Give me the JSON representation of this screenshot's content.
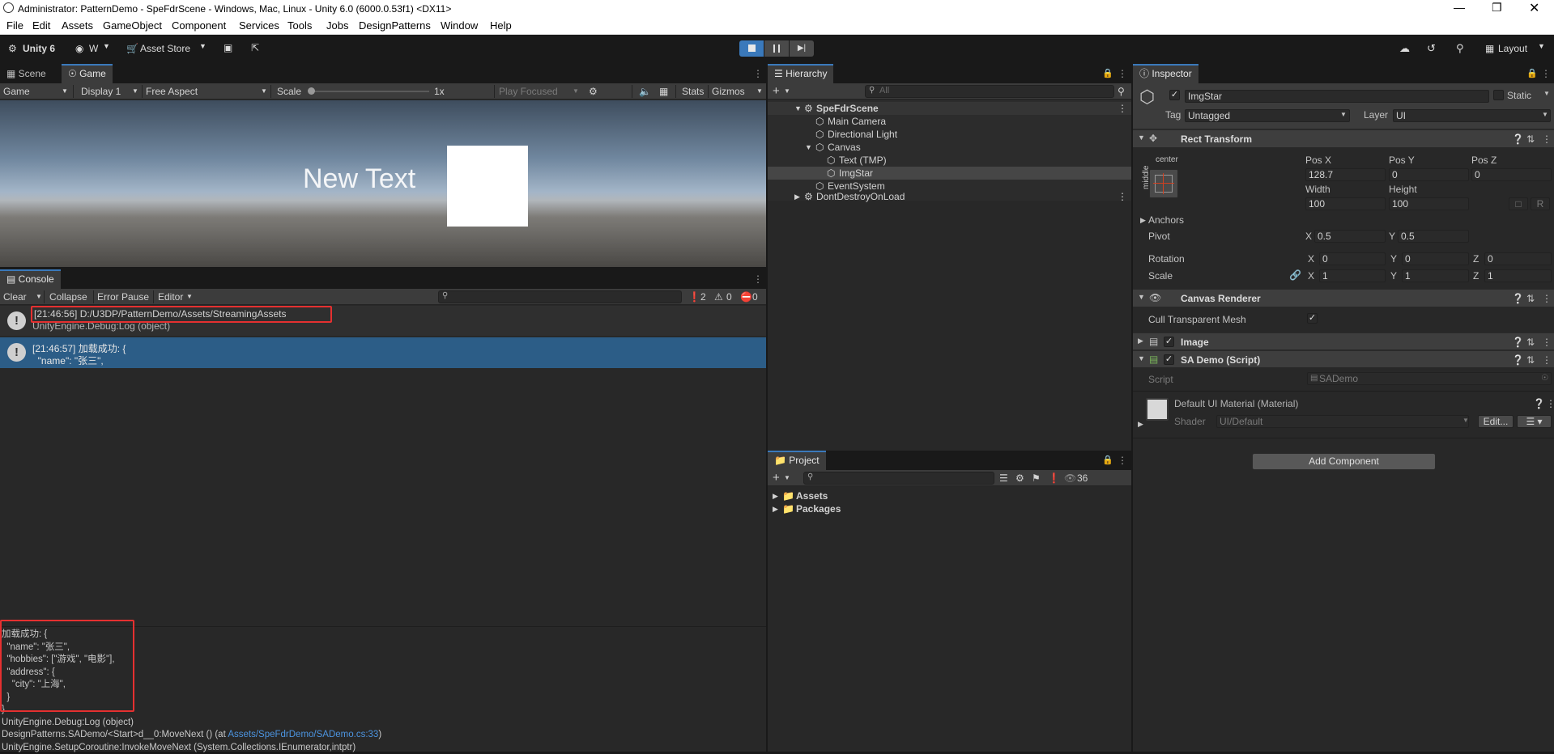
{
  "window": {
    "title": "Administrator: PatternDemo - SpeFdrScene - Windows, Mac, Linux - Unity 6.0 (6000.0.53f1) <DX11>"
  },
  "menu": [
    "File",
    "Edit",
    "Assets",
    "GameObject",
    "Component",
    "Services",
    "Tools",
    "Jobs",
    "DesignPatterns",
    "Window",
    "Help"
  ],
  "toolbar": {
    "unity": "Unity 6",
    "account": "W",
    "asset_store": "Asset Store",
    "layout": "Layout"
  },
  "scene_panel": {
    "tab_scene": "Scene",
    "tab_game": "Game",
    "game_mode": "Game",
    "display": "Display 1",
    "aspect": "Free Aspect",
    "scale_label": "Scale",
    "scale_value": "1x",
    "play_focused": "Play Focused",
    "stats": "Stats",
    "gizmos": "Gizmos",
    "viewport_text": "New Text"
  },
  "console": {
    "tab": "Console",
    "clear": "Clear",
    "collapse": "Collapse",
    "error_pause": "Error Pause",
    "editor": "Editor",
    "count_log": "2",
    "count_warn": "0",
    "count_err": "0",
    "entries": [
      {
        "line1": "[21:46:56] D:/U3DP/PatternDemo/Assets/StreamingAssets",
        "line2": "UnityEngine.Debug:Log (object)"
      },
      {
        "line1": "[21:46:57] 加载成功: {",
        "line2": "  \"name\": \"张三\","
      }
    ],
    "detail": [
      "加载成功: {",
      "  \"name\": \"张三\",",
      "  \"hobbies\": [\"游戏\", \"电影\"],",
      "  \"address\": {",
      "    \"city\": \"上海\",",
      "  }",
      "}",
      "UnityEngine.Debug:Log (object)"
    ],
    "stack_prefix": "DesignPatterns.SADemo/<Start>d__0:MoveNext () (at ",
    "stack_link": "Assets/SpeFdrDemo/SADemo.cs:33",
    "stack_suffix": ")",
    "stack_last": "UnityEngine.SetupCoroutine:InvokeMoveNext (System.Collections.IEnumerator,intptr)"
  },
  "hierarchy": {
    "tab": "Hierarchy",
    "search_placeholder": "All",
    "scene": "SpeFdrScene",
    "items": [
      "Main Camera",
      "Directional Light",
      "Canvas",
      "Text (TMP)",
      "ImgStar",
      "EventSystem"
    ],
    "dontdestroy": "DontDestroyOnLoad"
  },
  "project": {
    "tab": "Project",
    "count": "36",
    "folders": [
      "Assets",
      "Packages"
    ]
  },
  "inspector": {
    "tab": "Inspector",
    "object_name": "ImgStar",
    "static": "Static",
    "tag_label": "Tag",
    "tag_value": "Untagged",
    "layer_label": "Layer",
    "layer_value": "UI",
    "rect_transform": "Rect Transform",
    "anchor_h": "center",
    "anchor_v": "middle",
    "pos_x_label": "Pos X",
    "pos_y_label": "Pos Y",
    "pos_z_label": "Pos Z",
    "pos_x": "128.7",
    "pos_y": "0",
    "pos_z": "0",
    "width_label": "Width",
    "height_label": "Height",
    "width": "100",
    "height": "100",
    "r_btn": "R",
    "anchors": "Anchors",
    "pivot": "Pivot",
    "pivot_x": "0.5",
    "pivot_y": "0.5",
    "rotation": "Rotation",
    "rot_x": "0",
    "rot_y": "0",
    "rot_z": "0",
    "scale": "Scale",
    "scale_x": "1",
    "scale_y": "1",
    "scale_z": "1",
    "x": "X",
    "y": "Y",
    "z": "Z",
    "canvas_renderer": "Canvas Renderer",
    "cull": "Cull Transparent Mesh",
    "image": "Image",
    "sa_demo": "SA Demo (Script)",
    "script_label": "Script",
    "script_value": "SADemo",
    "material": "Default UI Material (Material)",
    "shader_label": "Shader",
    "shader_value": "UI/Default",
    "edit_btn": "Edit...",
    "add_component": "Add Component"
  },
  "colors": {
    "accent": "#3a79bb",
    "highlight": "#e53030",
    "selection": "#2c5d87",
    "link": "#4c94e0"
  }
}
